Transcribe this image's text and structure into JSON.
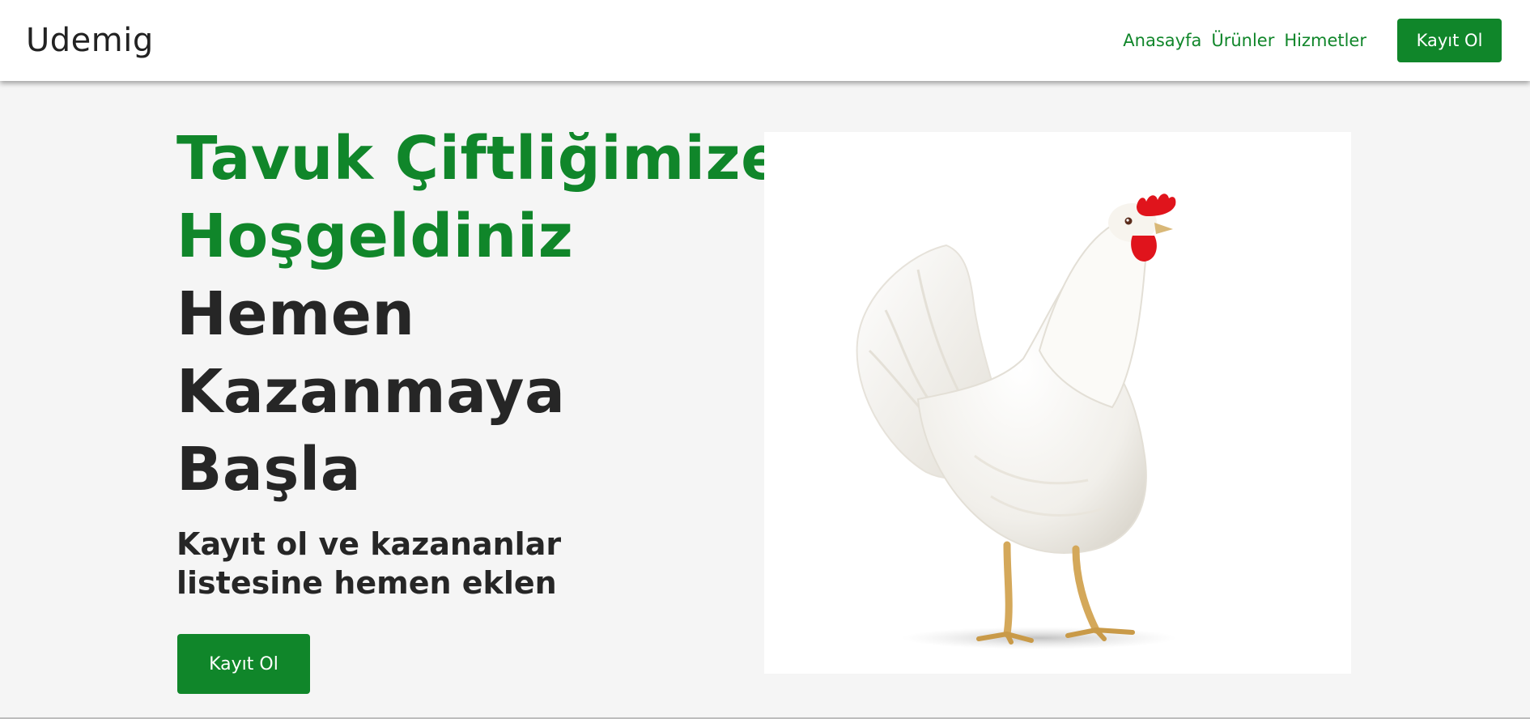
{
  "brand": {
    "name": "Udemig"
  },
  "nav": {
    "links": [
      "Anasayfa",
      "Ürünler",
      "Hizmetler"
    ],
    "cta_label": "Kayıt Ol"
  },
  "hero": {
    "heading_green": [
      "Tavuk Çiftliğimize",
      "Hoşgeldiniz"
    ],
    "heading_dark": [
      "Hemen",
      "Kazanmaya",
      "Başla"
    ],
    "subheading": "Kayıt ol ve kazananlar listesine hemen eklen",
    "cta_label": "Kayıt Ol",
    "image_icon": "white-hen-photo"
  },
  "colors": {
    "accent": "#10862a",
    "text_dark": "#262626",
    "background": "#f5f5f5",
    "navbar_bg": "#ffffff"
  }
}
